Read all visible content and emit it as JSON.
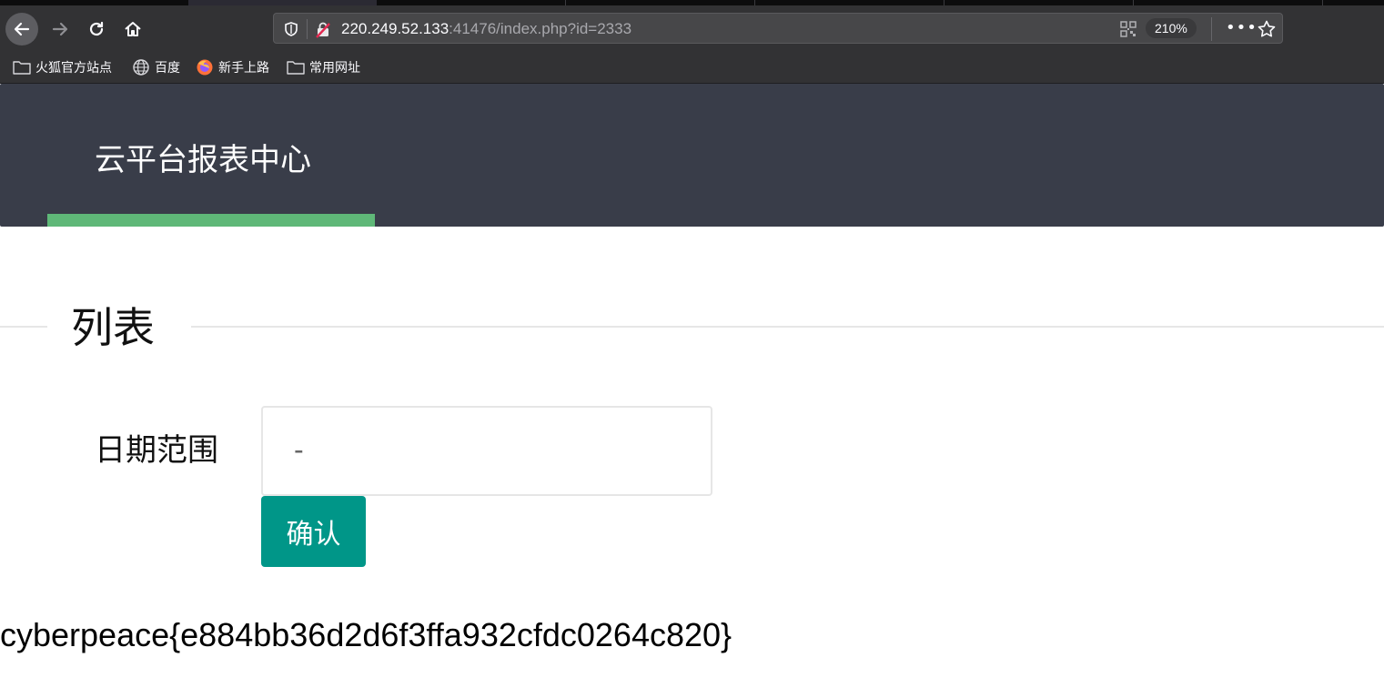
{
  "browser": {
    "url_host": "220.249.52.133",
    "url_rest": ":41476/index.php?id=2333",
    "zoom": "210%",
    "more_label": "•••",
    "bookmarks": [
      {
        "label": "火狐官方站点",
        "icon": "folder-icon"
      },
      {
        "label": "百度",
        "icon": "globe-icon"
      },
      {
        "label": "新手上路",
        "icon": "firefox-icon"
      },
      {
        "label": "常用网址",
        "icon": "folder-icon"
      }
    ]
  },
  "header": {
    "title": "云平台报表中心"
  },
  "main": {
    "legend": "列表",
    "date_label": "日期范围",
    "date_value": "-",
    "confirm_label": "确认",
    "flag_text": "cyberpeace{e884bb36d2d6f3ffa932cfdc0264c820}"
  },
  "colors": {
    "header_bg": "#393d49",
    "nav_active": "#5fb878",
    "button": "#009688"
  }
}
